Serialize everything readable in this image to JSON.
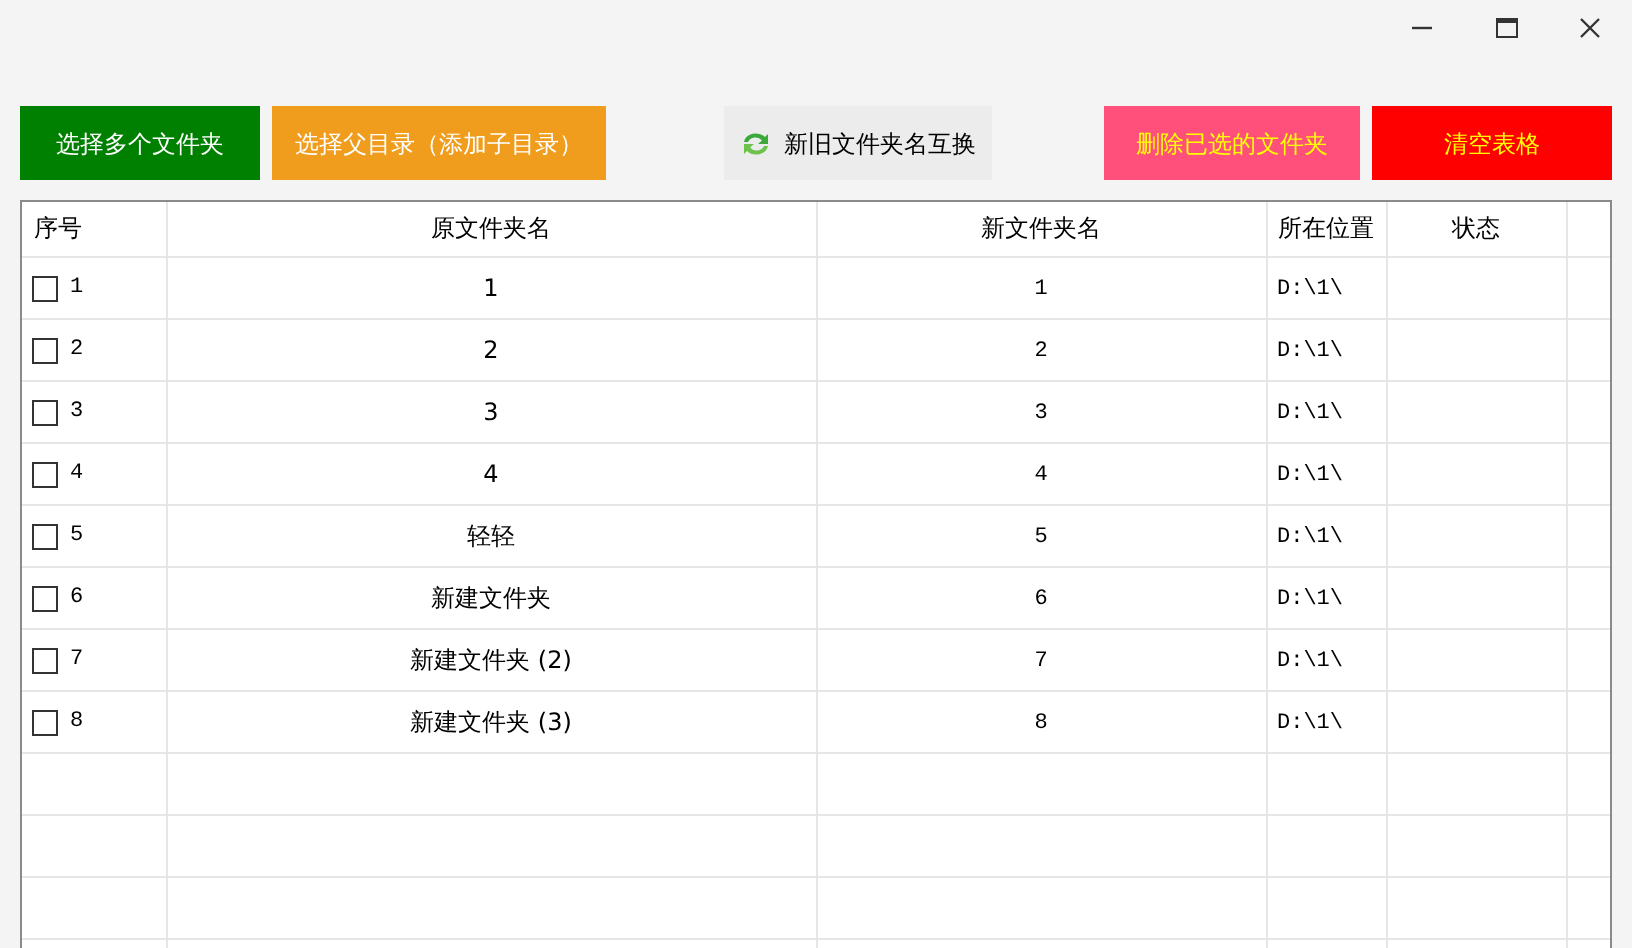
{
  "toolbar": [
    {
      "label": "选择多个文件夹",
      "kind": "light",
      "color": "#008000"
    },
    {
      "label": "选择父目录（添加子目录）",
      "kind": "light",
      "color": "#f09c1c"
    },
    {
      "label": "新旧文件夹名互换",
      "kind": "swap",
      "color": "#ececec"
    },
    {
      "label": "删除已选的文件夹",
      "kind": "warning",
      "color": "#ff4f7b"
    },
    {
      "label": "清空表格",
      "kind": "warning",
      "color": "#ff0000"
    }
  ],
  "table": {
    "columns": [
      "序号",
      "原文件夹名",
      "新文件夹名",
      "所在位置",
      "状态"
    ],
    "rows": [
      {
        "checked": false,
        "number": "1",
        "original_name": "1",
        "new_name": "1",
        "location": "D:\\1\\"
      },
      {
        "checked": false,
        "number": "2",
        "original_name": "2",
        "new_name": "2",
        "location": "D:\\1\\"
      },
      {
        "checked": false,
        "number": "3",
        "original_name": "3",
        "new_name": "3",
        "location": "D:\\1\\"
      },
      {
        "checked": false,
        "number": "4",
        "original_name": "4",
        "new_name": "4",
        "location": "D:\\1\\"
      },
      {
        "checked": false,
        "number": "5",
        "original_name": "轻轻",
        "new_name": "5",
        "location": "D:\\1\\"
      },
      {
        "checked": false,
        "number": "6",
        "original_name": "新建文件夹",
        "new_name": "6",
        "location": "D:\\1\\"
      },
      {
        "checked": false,
        "number": "7",
        "original_name": "新建文件夹 (2)",
        "new_name": "7",
        "location": "D:\\1\\"
      },
      {
        "checked": false,
        "number": "8",
        "original_name": "新建文件夹 (3)",
        "new_name": "8",
        "location": "D:\\1\\"
      }
    ]
  }
}
